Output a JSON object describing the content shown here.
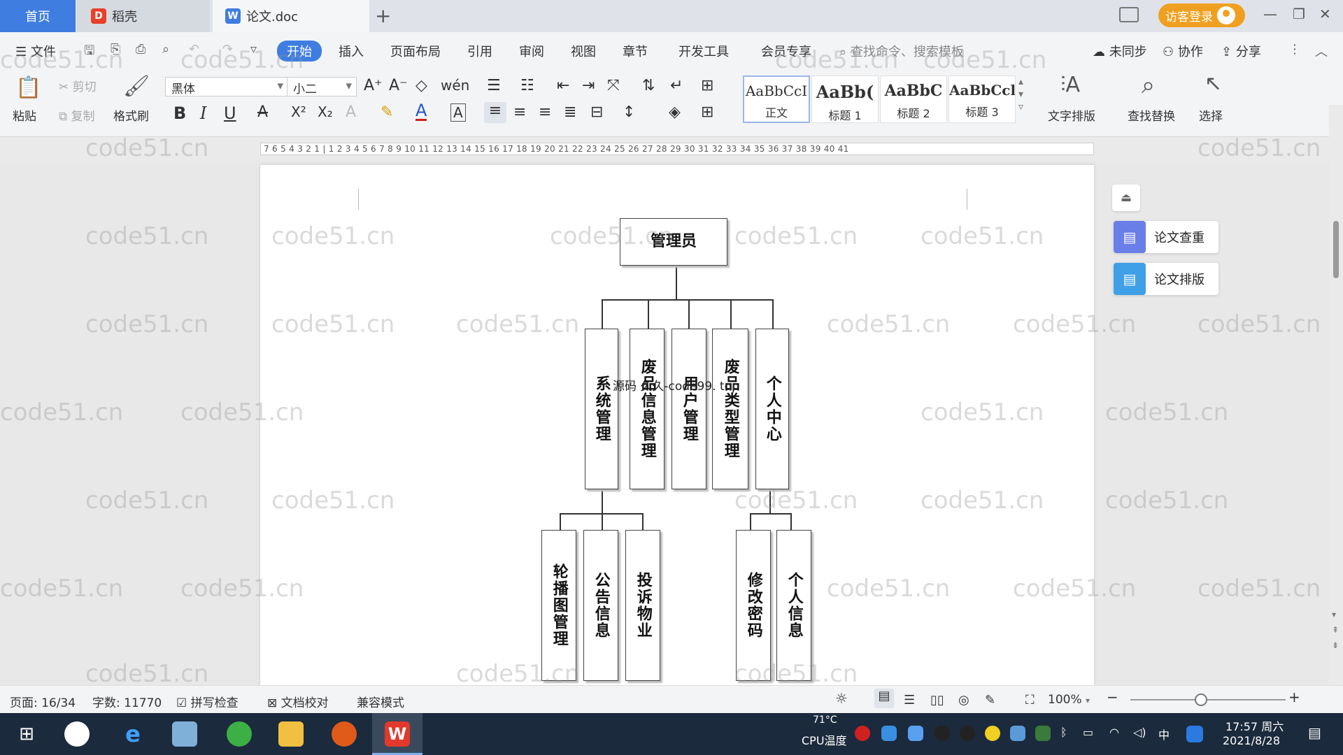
{
  "tabs": {
    "home": "首页",
    "daoke": "稻壳",
    "doc": "论文.doc",
    "new_tab": "+"
  },
  "account": {
    "login": "访客登录"
  },
  "menu": {
    "file": "文件",
    "items": [
      "开始",
      "插入",
      "页面布局",
      "引用",
      "审阅",
      "视图",
      "章节",
      "开发工具",
      "会员专享"
    ],
    "search_placeholder": "查找命令、搜索模板",
    "sync": "未同步",
    "collab": "协作",
    "share": "分享"
  },
  "ribbon": {
    "paste": "粘贴",
    "cut": "剪切",
    "copy": "复制",
    "format_painter": "格式刷",
    "font_name": "黑体",
    "font_size": "小二",
    "styles": [
      {
        "sample": "AaBbCcI",
        "label": "正文"
      },
      {
        "sample": "AaBb(",
        "label": "标题 1"
      },
      {
        "sample": "AaBbC",
        "label": "标题 2"
      },
      {
        "sample": "AaBbCcl",
        "label": "标题 3"
      }
    ],
    "text_layout": "文字排版",
    "find_replace": "查找替换",
    "select": "选择"
  },
  "ruler": {
    "ticks": "7 6 5 4 3 2 1 | 1 2 3 4 5 6 7 8 9 10 11 12 13 14 15 16 17 18 19 20 21 22 23 24 25 26 27 28 29 30 31 32 33 34 35 36 37 38 39 40 41"
  },
  "watermark": "code51.cn",
  "overlay_text": "源码 久久-code99. top",
  "org_chart": {
    "root": "管理员",
    "level1": [
      "系统管理",
      "废品信息管理",
      "用户管理",
      "废品类型管理",
      "个人中心"
    ],
    "system_children": [
      "轮播图管理",
      "公告信息",
      "投诉物业"
    ],
    "personal_children": [
      "修改密码",
      "个人信息"
    ]
  },
  "side_panel": {
    "check": "论文查重",
    "layout": "论文排版"
  },
  "status": {
    "page": "页面: 16/34",
    "words": "字数: 11770",
    "spell": "拼写检查",
    "proof": "文档校对",
    "compat": "兼容模式",
    "zoom": "100%"
  },
  "taskbar": {
    "temp": "71°C",
    "cpu": "CPU温度",
    "ime": "中",
    "time": "17:57 周六",
    "date": "2021/8/28"
  },
  "colors": {
    "accent": "#3f7de0",
    "login": "#f0a020",
    "taskbar": "#1b2a3c"
  }
}
